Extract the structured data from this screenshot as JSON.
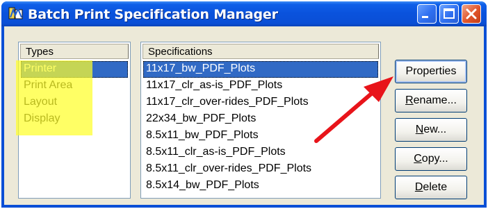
{
  "window": {
    "title": "Batch Print Specification Manager",
    "icon": "microstation-icon",
    "buttons": [
      "minimize-icon",
      "maximize-icon",
      "close-icon"
    ]
  },
  "types": {
    "header": "Types",
    "items": [
      {
        "label": "Printer",
        "selected": true
      },
      {
        "label": "Print Area",
        "selected": false
      },
      {
        "label": "Layout",
        "selected": false
      },
      {
        "label": "Display",
        "selected": false
      }
    ]
  },
  "specifications": {
    "header": "Specifications",
    "items": [
      {
        "label": "11x17_bw_PDF_Plots",
        "selected": true
      },
      {
        "label": "11x17_clr_as-is_PDF_Plots",
        "selected": false
      },
      {
        "label": "11x17_clr_over-rides_PDF_Plots",
        "selected": false
      },
      {
        "label": "22x34_bw_PDF_Plots",
        "selected": false
      },
      {
        "label": "8.5x11_bw_PDF_Plots",
        "selected": false
      },
      {
        "label": "8.5x11_clr_as-is_PDF_Plots",
        "selected": false
      },
      {
        "label": "8.5x11_clr_over-rides_PDF_Plots",
        "selected": false
      },
      {
        "label": "8.5x14_bw_PDF_Plots",
        "selected": false
      }
    ]
  },
  "actions": {
    "properties": {
      "label": "Properties"
    },
    "rename": {
      "label": "Rename...",
      "accel": "R",
      "rest": "ename..."
    },
    "new": {
      "label": "New...",
      "accel": "N",
      "rest": "ew..."
    },
    "copy": {
      "label": "Copy...",
      "accel": "C",
      "rest": "opy..."
    },
    "delete": {
      "label": "Delete",
      "accel": "D",
      "rest": "elete"
    }
  },
  "annotations": {
    "highlight_color": "#ffff2a",
    "arrow_color": "#e8141a"
  }
}
